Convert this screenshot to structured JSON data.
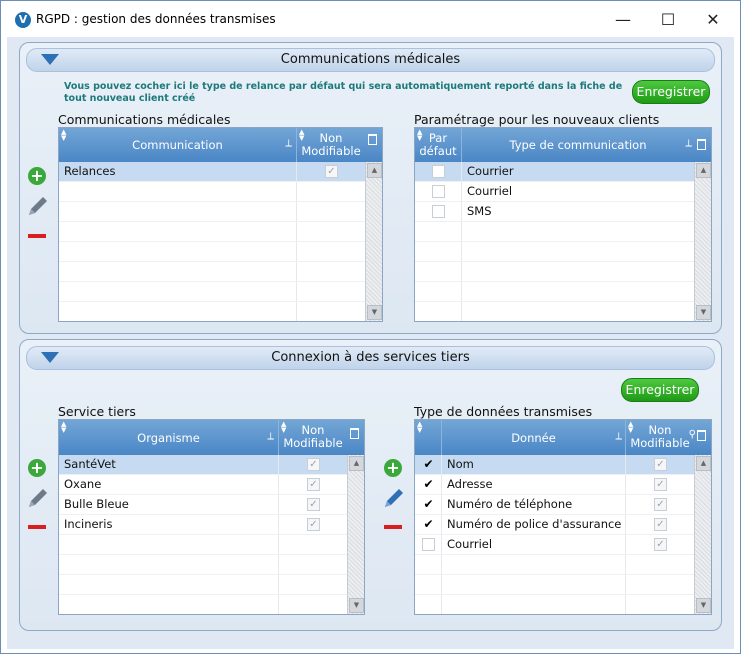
{
  "window": {
    "title": "RGPD : gestion des données transmises",
    "minimize": "—",
    "maximize": "☐",
    "close": "✕"
  },
  "section1": {
    "title": "Communications médicales",
    "note": "Vous pouvez cocher ici le type de relance par défaut qui sera automatiquement reporté dans la fiche de tout nouveau client créé",
    "save_label": "Enregistrer",
    "left_grid": {
      "label": "Communications médicales",
      "columns": [
        "Communication",
        "Non Modifiable"
      ],
      "rows": [
        {
          "name": "Relances",
          "locked": true
        }
      ]
    },
    "right_grid": {
      "label": "Paramétrage pour les nouveaux clients",
      "columns": [
        "Par défaut",
        "Type de communication"
      ],
      "rows": [
        {
          "default": false,
          "type": "Courrier"
        },
        {
          "default": false,
          "type": "Courriel"
        },
        {
          "default": false,
          "type": "SMS"
        }
      ]
    }
  },
  "section2": {
    "title": "Connexion à des services tiers",
    "save_label": "Enregistrer",
    "left_grid": {
      "label": "Service tiers",
      "columns": [
        "Organisme",
        "Non Modifiable"
      ],
      "rows": [
        {
          "name": "SantéVet",
          "locked": true
        },
        {
          "name": "Oxane",
          "locked": true
        },
        {
          "name": "Bulle Bleue",
          "locked": true
        },
        {
          "name": "Incineris",
          "locked": true
        }
      ]
    },
    "right_grid": {
      "label": "Type de données transmises",
      "columns": [
        "Donnée",
        "Non Modifiable"
      ],
      "rows": [
        {
          "checked": true,
          "name": "Nom",
          "locked": true
        },
        {
          "checked": true,
          "name": "Adresse",
          "locked": true
        },
        {
          "checked": true,
          "name": "Numéro de téléphone",
          "locked": true
        },
        {
          "checked": true,
          "name": "Numéro de police d'assurance",
          "locked": true
        },
        {
          "checked": false,
          "name": "Courriel",
          "locked": true
        }
      ]
    }
  },
  "colors": {
    "accent": "#4a86c6",
    "save": "#1f9a17",
    "note": "#1d7a7a",
    "delete": "#d81e1e"
  }
}
